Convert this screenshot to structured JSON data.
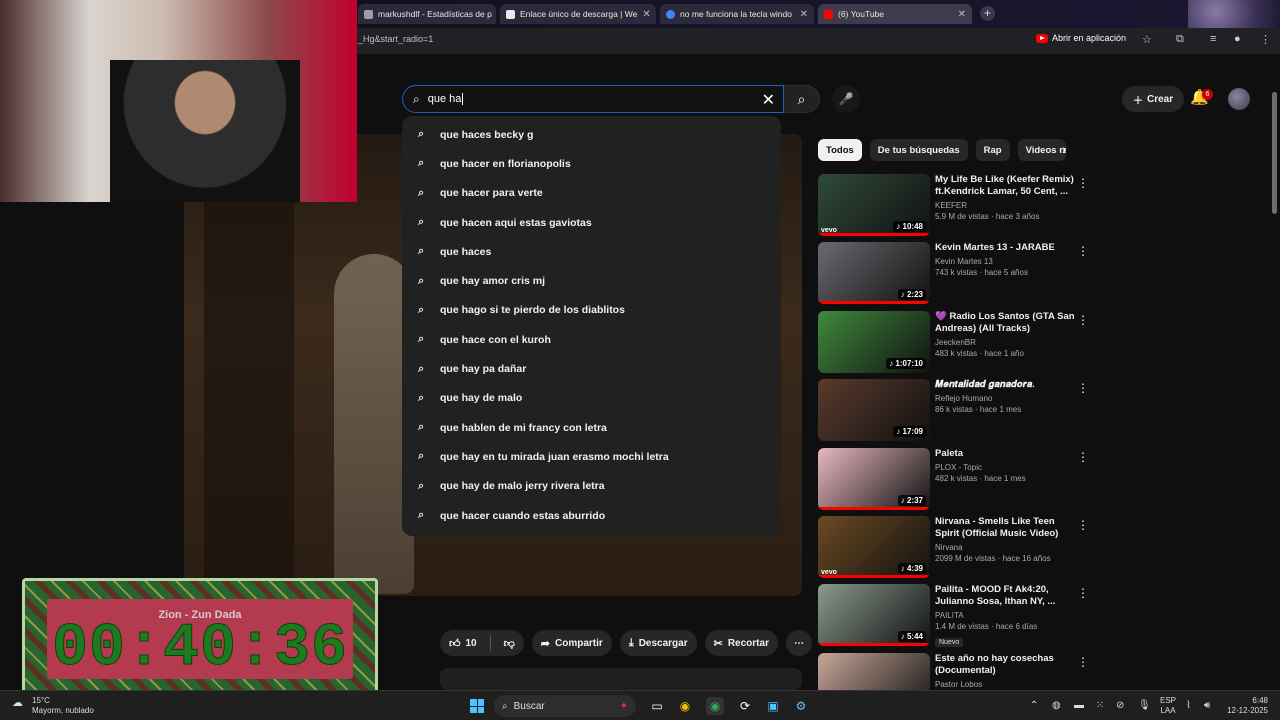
{
  "browser": {
    "tabs": [
      {
        "title": "markushdlf - Estadísticas de p",
        "color": "#9aa0a6"
      },
      {
        "title": "Enlace único de descarga | We",
        "color": "#e8eaed"
      },
      {
        "title": "no me funciona la tecla windo",
        "color": "#4285f4"
      },
      {
        "title": "(6) YouTube",
        "color": "#ff0000"
      }
    ],
    "new_tab": "+",
    "url": "_Hg&start_radio=1",
    "open_in_app": "Abrir en aplicación"
  },
  "header": {
    "search_query": "que ha",
    "create_label": "Crear",
    "notification_count": "6"
  },
  "suggestions": [
    "que haces becky g",
    "que hacer en florianopolis",
    "que hacer para verte",
    "que hacen aqui estas gaviotas",
    "que haces",
    "que hay amor cris mj",
    "que hago si te pierdo de los diablitos",
    "que hace con el kuroh",
    "que hay pa dañar",
    "que hay de malo",
    "que hablen de mi francy con letra",
    "que hay en tu mirada juan erasmo mochi letra",
    "que hay de malo jerry rivera letra",
    "que hacer cuando estas aburrido"
  ],
  "actions": {
    "likes": "10",
    "share": "Compartir",
    "download": "Descargar",
    "clip": "Recortar"
  },
  "chips": [
    "Todos",
    "De tus búsquedas",
    "Rap",
    "Videos rel"
  ],
  "videos": [
    {
      "title": "My Life Be Like (Keefer Remix) ft.Kendrick Lamar, 50 Cent, ...",
      "channel": "KEEFER",
      "meta": "5.9 M de vistas · hace 3 años",
      "duration": "10:48",
      "vevo": "vevo",
      "thumb": "#2f4a3a",
      "progress": 1.0
    },
    {
      "title": "Kevin Martes 13 - JARABE",
      "channel": "Kevin Martes 13",
      "meta": "743 k vistas · hace 5 años",
      "duration": "2:23",
      "vevo": "",
      "thumb": "#6a6a70",
      "progress": 1.0
    },
    {
      "title": "💜 Radio Los Santos (GTA San Andreas) (All Tracks)",
      "channel": "JeeckenBR",
      "meta": "483 k vistas · hace 1 año",
      "duration": "1:07:10",
      "vevo": "",
      "thumb": "#3f8a3c",
      "progress": 0.0
    },
    {
      "title": "𝑴𝒆𝒏𝒕𝒂𝒍𝒊𝒅𝒂𝒅 𝒈𝒂𝒏𝒂𝒅𝒐𝒓𝒂.",
      "channel": "Reflejo Humano",
      "meta": "86 k vistas · hace 1 mes",
      "duration": "17:09",
      "vevo": "",
      "thumb": "#5a3a2c",
      "progress": 0.0
    },
    {
      "title": "Paleta",
      "channel": "PLOX - Topic",
      "meta": "482 k vistas · hace 1 mes",
      "duration": "2:37",
      "vevo": "",
      "thumb": "#e8b8c0",
      "progress": 1.0
    },
    {
      "title": "Nirvana - Smells Like Teen Spirit (Official Music Video)",
      "channel": "Nirvana",
      "meta": "2099 M de vistas · hace 16 años",
      "duration": "4:39",
      "vevo": "vevo",
      "thumb": "#6b4a22",
      "progress": 1.0
    },
    {
      "title": "Pailita - MOOD Ft Ak4:20, Julianno Sosa, Ithan NY, ...",
      "channel": "PAILITA",
      "meta": "1.4 M de vistas · hace 6 días",
      "duration": "5:44",
      "vevo": "",
      "thumb": "#8a9a8e",
      "badge": "Nuevo",
      "progress": 1.0
    },
    {
      "title": "Este año no hay cosechas (Documental)",
      "channel": "Pastor Lobos",
      "meta": "",
      "duration": "",
      "vevo": "",
      "thumb": "#c8a79a",
      "progress": 0.0
    }
  ],
  "overlay": {
    "song": "Zion - Zun Dada",
    "timer": "00:40:36"
  },
  "taskbar": {
    "temp": "15°C",
    "weather": "Mayorm. nublado",
    "search": "Buscar",
    "lang1": "ESP",
    "lang2": "LAA",
    "time": "6:48",
    "date": "12-12-2025"
  }
}
